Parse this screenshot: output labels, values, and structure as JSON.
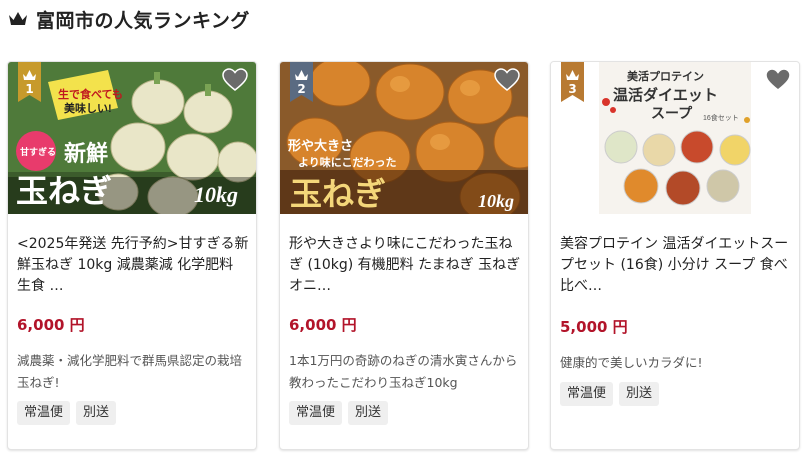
{
  "header": {
    "title": "富岡市の人気ランキング",
    "icon": "crown-icon"
  },
  "colors": {
    "gold": "#c79a2c",
    "bronze": "#b87a32",
    "silver": "#5a6b82",
    "price": "#b2142a"
  },
  "products": [
    {
      "rank": "1",
      "image_text": {
        "badge_line1": "生で食べても",
        "badge_line2": "美味しい!",
        "sweet": "甘すぎる",
        "fresh": "新鮮",
        "main": "玉ねぎ",
        "weight": "10kg"
      },
      "title": "<2025年発送 先行予約>甘すぎる新鮮玉ねぎ 10kg 減農薬減 化学肥料 生食 …",
      "price": "6,000 円",
      "description": "減農薬・減化学肥料で群馬県認定の栽培玉ねぎ!",
      "tags": [
        "常温便",
        "別送"
      ]
    },
    {
      "rank": "2",
      "image_text": {
        "line1": "形や大きさ",
        "line2": "より味にこだわった",
        "main": "玉ねぎ",
        "weight": "10kg"
      },
      "title": "形や大きさより味にこだわった玉ねぎ (10kg) 有機肥料 たまねぎ 玉ねぎ オニ…",
      "price": "6,000 円",
      "description": "1本1万円の奇跡のねぎの清水寅さんから教わったこだわり玉ねぎ10kg",
      "tags": [
        "常温便",
        "別送"
      ]
    },
    {
      "rank": "3",
      "image_text": {
        "line1": "美活プロテイン",
        "line2": "温活ダイエット",
        "line3": "スープ",
        "set": "16食セット"
      },
      "title": "美容プロテイン 温活ダイエットスープセット (16食) 小分け スープ 食べ比べ…",
      "price": "5,000 円",
      "description": "健康的で美しいカラダに!",
      "tags": [
        "常温便",
        "別送"
      ]
    }
  ]
}
